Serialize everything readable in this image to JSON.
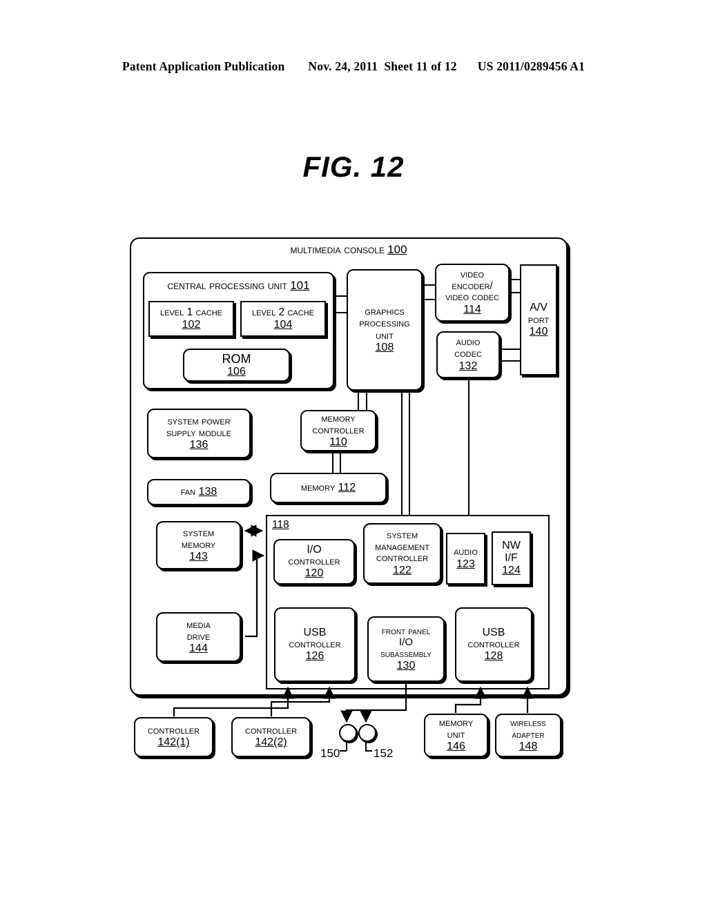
{
  "header": {
    "publication": "Patent Application Publication",
    "date": "Nov. 24, 2011",
    "sheet": "Sheet 11 of 12",
    "doc_number": "US 2011/0289456 A1"
  },
  "figure": {
    "title": "FIG. 12"
  },
  "diagram": {
    "console": {
      "label": "Multimedia Console",
      "ref": "100"
    },
    "io_bus": {
      "ref": "118"
    },
    "blocks": {
      "cpu": {
        "lines": [
          "Central Processing Unit"
        ],
        "ref": "101",
        "inline_ref": true
      },
      "l1_cache": {
        "lines": [
          "Level 1 Cache"
        ],
        "ref": "102"
      },
      "l2_cache": {
        "lines": [
          "Level 2 Cache"
        ],
        "ref": "104"
      },
      "rom": {
        "lines": [
          "ROM"
        ],
        "ref": "106"
      },
      "gpu": {
        "lines": [
          "Graphics",
          "Processing",
          "Unit"
        ],
        "ref": "108"
      },
      "video_encoder": {
        "lines": [
          "Video",
          "Encoder/",
          "Video Codec"
        ],
        "ref": "114"
      },
      "audio_codec": {
        "lines": [
          "Audio",
          "Codec"
        ],
        "ref": "132"
      },
      "av_port": {
        "lines": [
          "A/V",
          "Port"
        ],
        "ref": "140"
      },
      "power_supply": {
        "lines": [
          "System Power",
          "Supply Module"
        ],
        "ref": "136"
      },
      "fan": {
        "lines": [
          "Fan"
        ],
        "ref": "138",
        "inline_ref": true
      },
      "memory_ctrl": {
        "lines": [
          "Memory",
          "Controller"
        ],
        "ref": "110"
      },
      "memory": {
        "lines": [
          "Memory"
        ],
        "ref": "112",
        "inline_ref": true
      },
      "system_memory": {
        "lines": [
          "System",
          "Memory"
        ],
        "ref": "143"
      },
      "media_drive": {
        "lines": [
          "Media",
          "Drive"
        ],
        "ref": "144"
      },
      "io_controller": {
        "lines": [
          "I/O",
          "Controller"
        ],
        "ref": "120"
      },
      "sys_mgmt_ctrl": {
        "lines": [
          "System",
          "Management",
          "Controller"
        ],
        "ref": "122"
      },
      "audio": {
        "lines": [
          "Audio"
        ],
        "ref": "123"
      },
      "nw_if": {
        "lines": [
          "NW",
          "I/F"
        ],
        "ref": "124"
      },
      "usb_ctrl_1": {
        "lines": [
          "USB",
          "Controller"
        ],
        "ref": "126"
      },
      "front_panel": {
        "lines": [
          "Front Panel",
          "I/O",
          "Subassembly"
        ],
        "ref": "130"
      },
      "usb_ctrl_2": {
        "lines": [
          "USB",
          "Controller"
        ],
        "ref": "128"
      },
      "controller_1": {
        "lines": [
          "Controller"
        ],
        "ref": "142(1)"
      },
      "controller_2": {
        "lines": [
          "Controller"
        ],
        "ref": "142(2)"
      },
      "memory_unit": {
        "lines": [
          "Memory",
          "Unit"
        ],
        "ref": "146"
      },
      "wireless_adapter": {
        "lines": [
          "Wireless",
          "adapter"
        ],
        "ref": "148"
      }
    },
    "connector_labels": {
      "port_150": "150",
      "port_152": "152"
    }
  }
}
